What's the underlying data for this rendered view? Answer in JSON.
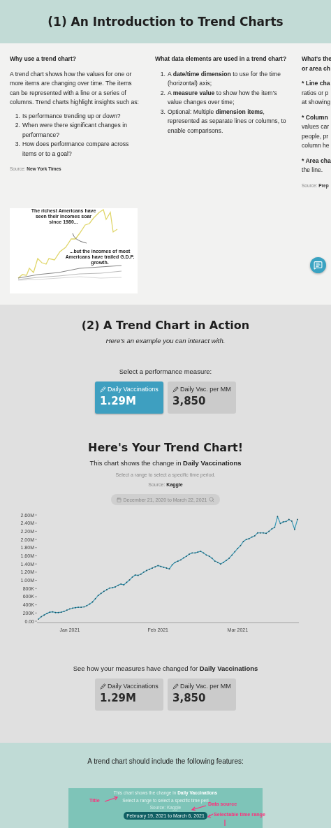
{
  "header": {
    "title": "(1) An Introduction to Trend Charts"
  },
  "intro": {
    "columns": [
      {
        "kind": "text",
        "heading": "Why use a trend chart?",
        "paragraph": "A trend chart shows how the values for one or more items are changing over time. The items can be represented with a line or a series of columns. Trend charts highlight insights such as:",
        "items": [
          {
            "marker": "1.",
            "text": "Is performance trending up or down?"
          },
          {
            "marker": "2.",
            "text": "When were there significant changes in performance?"
          },
          {
            "marker": "3.",
            "text": "How does performance compare across items or to a goal?"
          }
        ],
        "source": "Source: **New York Times**"
      },
      {
        "kind": "text",
        "heading": "What data elements are used in a trend chart?",
        "items": [
          {
            "marker": "1.",
            "text": "A **date/time dimension** to use for the time (horizontal) axis;"
          },
          {
            "marker": "2.",
            "text": "A **measure value** to show how the item's value changes over time;"
          },
          {
            "marker": "3.",
            "text": "Optional: Multiple **dimension items**, represented as separate lines or columns, to enable comparisons."
          }
        ]
      },
      {
        "kind": "clipped",
        "blocks": [
          {
            "lines": [
              {
                "text": "What's the",
                "bold": true
              },
              {
                "text": "or area ch",
                "bold": true
              }
            ]
          },
          {
            "lines": [
              {
                "text": "* Line cha",
                "bold": true
              },
              {
                "text": "ratios or p",
                "bold": false
              },
              {
                "text": "at showing",
                "bold": false
              }
            ]
          },
          {
            "lines": [
              {
                "text": "* Column",
                "bold": true
              },
              {
                "text": "values car",
                "bold": false
              },
              {
                "text": "people, pr",
                "bold": false
              },
              {
                "text": "column he",
                "bold": false
              }
            ]
          },
          {
            "lines": [
              {
                "text": "* Area cha",
                "bold": true
              },
              {
                "text": "the line.",
                "bold": false
              }
            ]
          }
        ],
        "source": "Source: **Prep**"
      }
    ],
    "figure": {
      "annotations": [
        "The richest Americans have seen their incomes soar since 1980...",
        "...but the incomes of most Americans have trailed G.D.P. growth."
      ]
    }
  },
  "demo": {
    "title": "(2) A Trend Chart in Action",
    "subtitle": "Here's an example you can interact with.",
    "prompt": "Select a performance measure:",
    "measures": [
      {
        "label": "Daily Vaccinations",
        "value": "1.29M",
        "selected": true
      },
      {
        "label": "Daily Vac. per MM",
        "value": "3,850",
        "selected": false
      }
    ],
    "chart_title": "Here's Your Trend Chart!",
    "chart_caption": "This chart shows the change in **Daily Vaccinations**",
    "hint": "Select a range to select a specific time period.",
    "source": "Source: **Kaggle**",
    "date_range": "December 21, 2020 to March 22, 2021",
    "chart_data": {
      "type": "line",
      "ylim": [
        0,
        2600000
      ],
      "categories": [
        null,
        null,
        null,
        null,
        null,
        null,
        null,
        null,
        null,
        null,
        null,
        "Jan 2021",
        null,
        null,
        null,
        null,
        null,
        null,
        null,
        null,
        null,
        null,
        null,
        null,
        null,
        null,
        null,
        null,
        null,
        null,
        null,
        null,
        null,
        null,
        null,
        null,
        null,
        null,
        null,
        null,
        null,
        null,
        "Feb 2021",
        null,
        null,
        null,
        null,
        null,
        null,
        null,
        null,
        null,
        null,
        null,
        null,
        null,
        null,
        null,
        null,
        null,
        null,
        null,
        null,
        null,
        null,
        null,
        null,
        null,
        null,
        null,
        "Mar 2021",
        null,
        null,
        null,
        null,
        null,
        null,
        null,
        null,
        null,
        null,
        null,
        null,
        null,
        null,
        null,
        null,
        null,
        null,
        null,
        null,
        null
      ],
      "yticks": [
        {
          "value": 0,
          "label": "0.00"
        },
        {
          "value": 200000,
          "label": "200K"
        },
        {
          "value": 400000,
          "label": "400K"
        },
        {
          "value": 600000,
          "label": "600K"
        },
        {
          "value": 800000,
          "label": "800K"
        },
        {
          "value": 1000000,
          "label": "1.00M"
        },
        {
          "value": 1200000,
          "label": "1.20M"
        },
        {
          "value": 1400000,
          "label": "1.40M"
        },
        {
          "value": 1600000,
          "label": "1.60M"
        },
        {
          "value": 1800000,
          "label": "1.80M"
        },
        {
          "value": 2000000,
          "label": "2.00M"
        },
        {
          "value": 2200000,
          "label": "2.20M"
        },
        {
          "value": 2400000,
          "label": "2.40M"
        },
        {
          "value": 2600000,
          "label": "2.60M"
        }
      ],
      "series": [
        {
          "color": "#3a9bb8",
          "values": [
            50000,
            110000,
            150000,
            190000,
            220000,
            230000,
            210000,
            210000,
            220000,
            240000,
            270000,
            300000,
            320000,
            330000,
            340000,
            340000,
            350000,
            380000,
            420000,
            470000,
            550000,
            630000,
            680000,
            730000,
            770000,
            810000,
            820000,
            840000,
            880000,
            910000,
            890000,
            950000,
            1010000,
            1080000,
            1130000,
            1120000,
            1150000,
            1200000,
            1240000,
            1270000,
            1300000,
            1330000,
            1360000,
            1340000,
            1320000,
            1300000,
            1280000,
            1380000,
            1440000,
            1470000,
            1500000,
            1550000,
            1590000,
            1640000,
            1670000,
            1670000,
            1690000,
            1710000,
            1670000,
            1620000,
            1590000,
            1540000,
            1470000,
            1440000,
            1400000,
            1440000,
            1490000,
            1540000,
            1620000,
            1700000,
            1780000,
            1850000,
            1950000,
            2000000,
            2020000,
            2060000,
            2090000,
            2160000,
            2160000,
            2160000,
            2150000,
            2200000,
            2260000,
            2300000,
            2560000,
            2390000,
            2430000,
            2440000,
            2490000,
            2450000,
            2250000,
            2490000
          ]
        }
      ]
    },
    "comparison": {
      "caption": "See how your measures have changed for **Daily Vaccinations**",
      "measures": [
        {
          "label": "Daily Vaccinations",
          "value": "1.29M",
          "selected": false
        },
        {
          "label": "Daily Vac. per MM",
          "value": "3,850",
          "selected": false
        }
      ]
    }
  },
  "features": {
    "title": "A trend chart should include the following features:",
    "example": {
      "caption": "This chart shows the change in **Daily Vaccinations**",
      "hint": "Select a range to select a specific time peri",
      "source": "Source: Kaggle",
      "date_range": "February 19, 2021 to March 6, 2021",
      "callouts": [
        "Title",
        "Data source",
        "Selectable time range"
      ]
    }
  }
}
